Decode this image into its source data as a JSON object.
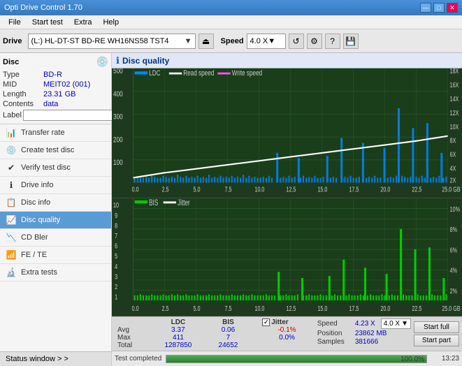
{
  "app": {
    "title": "Opti Drive Control 1.70",
    "titlebar_buttons": [
      "—",
      "□",
      "✕"
    ]
  },
  "menu": {
    "items": [
      "File",
      "Start test",
      "Extra",
      "Help"
    ]
  },
  "toolbar": {
    "drive_label": "Drive",
    "drive_value": "(L:)  HL-DT-ST BD-RE  WH16NS58 TST4",
    "speed_label": "Speed",
    "speed_value": "4.0 X"
  },
  "sidebar": {
    "disc_title": "Disc",
    "disc_fields": [
      {
        "label": "Type",
        "value": "BD-R"
      },
      {
        "label": "MID",
        "value": "MEIT02 (001)"
      },
      {
        "label": "Length",
        "value": "23.31 GB"
      },
      {
        "label": "Contents",
        "value": "data"
      },
      {
        "label": "Label",
        "value": ""
      }
    ],
    "nav_items": [
      {
        "id": "transfer-rate",
        "label": "Transfer rate",
        "active": false
      },
      {
        "id": "create-test-disc",
        "label": "Create test disc",
        "active": false
      },
      {
        "id": "verify-test-disc",
        "label": "Verify test disc",
        "active": false
      },
      {
        "id": "drive-info",
        "label": "Drive info",
        "active": false
      },
      {
        "id": "disc-info",
        "label": "Disc info",
        "active": false
      },
      {
        "id": "disc-quality",
        "label": "Disc quality",
        "active": true
      },
      {
        "id": "cd-bler",
        "label": "CD Bler",
        "active": false
      },
      {
        "id": "fe-te",
        "label": "FE / TE",
        "active": false
      },
      {
        "id": "extra-tests",
        "label": "Extra tests",
        "active": false
      }
    ],
    "status_window_btn": "Status window > >"
  },
  "disc_quality": {
    "title": "Disc quality",
    "legend_top": [
      {
        "label": "LDC",
        "color": "#00aaff"
      },
      {
        "label": "Read speed",
        "color": "#ffffff"
      },
      {
        "label": "Write speed",
        "color": "#ff00ff"
      }
    ],
    "legend_bottom": [
      {
        "label": "BIS",
        "color": "#00ff00"
      },
      {
        "label": "Jitter",
        "color": "#ffffff"
      }
    ],
    "x_axis_top": [
      "0.0",
      "2.5",
      "5.0",
      "7.5",
      "10.0",
      "12.5",
      "15.0",
      "17.5",
      "20.0",
      "22.5",
      "25.0 GB"
    ],
    "y_axis_top_left": [
      "500",
      "400",
      "300",
      "200",
      "100"
    ],
    "y_axis_top_right": [
      "18X",
      "16X",
      "14X",
      "12X",
      "10X",
      "8X",
      "6X",
      "4X",
      "2X"
    ],
    "x_axis_bottom": [
      "0.0",
      "2.5",
      "5.0",
      "7.5",
      "10.0",
      "12.5",
      "15.0",
      "17.5",
      "20.0",
      "22.5",
      "25.0 GB"
    ],
    "y_axis_bottom_left": [
      "10",
      "9",
      "8",
      "7",
      "6",
      "5",
      "4",
      "3",
      "2",
      "1"
    ],
    "y_axis_bottom_right": [
      "10%",
      "8%",
      "6%",
      "4%",
      "2%"
    ]
  },
  "stats": {
    "columns": [
      "LDC",
      "BIS",
      "",
      "Jitter",
      "Speed"
    ],
    "avg": {
      "ldc": "3.37",
      "bis": "0.06",
      "jitter": "-0.1%",
      "speed_label": "4.23 X"
    },
    "max": {
      "ldc": "411",
      "bis": "7",
      "jitter": "0.0%"
    },
    "total": {
      "ldc": "1287850",
      "bis": "24652"
    },
    "position": {
      "label": "Position",
      "value": "23862 MB"
    },
    "samples": {
      "label": "Samples",
      "value": "381666"
    },
    "speed_select": "4.0 X",
    "jitter_checked": true,
    "jitter_label": "Jitter",
    "buttons": [
      "Start full",
      "Start part"
    ]
  },
  "progress": {
    "label": "Test completed",
    "percent": 100,
    "percent_text": "100.0%",
    "time": "13:23"
  }
}
